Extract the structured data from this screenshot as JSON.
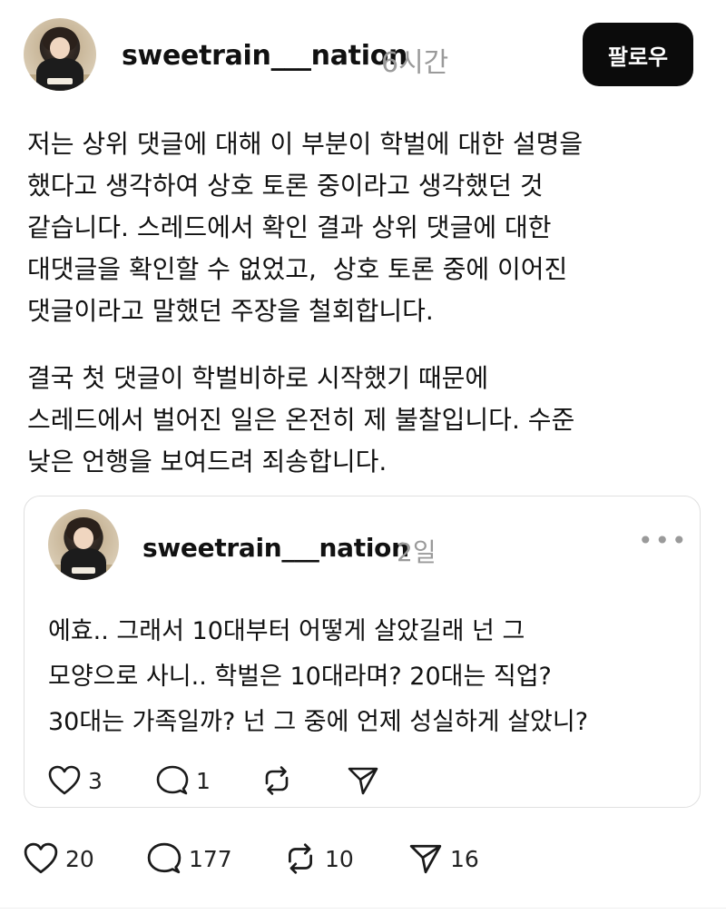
{
  "post": {
    "username": "sweetrain___nation",
    "time": "6시간",
    "follow_label": "팔로우",
    "paragraph1": "저는 상위 댓글에 대해 이 부분이 학벌에 대한 설명을\n했다고 생각하여 상호 토론 중이라고 생각했던 것\n같습니다. 스레드에서 확인 결과 상위 댓글에 대한\n대댓글을 확인할 수 없었고,  상호 토론 중에 이어진\n댓글이라고 말했던 주장을 철회합니다.",
    "paragraph2": "결국 첫 댓글이 학벌비하로 시작했기 때문에\n스레드에서 벌어진 일은 온전히 제 불찰입니다. 수준\n낮은 언행을 보여드려 죄송합니다.",
    "stats": {
      "likes": "20",
      "replies": "177",
      "reposts": "10",
      "shares": "16"
    }
  },
  "quoted_post": {
    "username": "sweetrain___nation",
    "time": "2일",
    "more": "•••",
    "text": "에효.. 그래서 10대부터 어떻게 살았길래 넌 그\n모양으로 사니.. 학벌은 10대라며? 20대는 직업?\n30대는 가족일까? 넌 그 중에 언제 성실하게 살았니?",
    "stats": {
      "likes": "3",
      "replies": "1"
    }
  },
  "icons": {
    "like": "heart-icon",
    "reply": "comment-icon",
    "repost": "repost-icon",
    "share": "send-icon",
    "more": "more-icon"
  }
}
